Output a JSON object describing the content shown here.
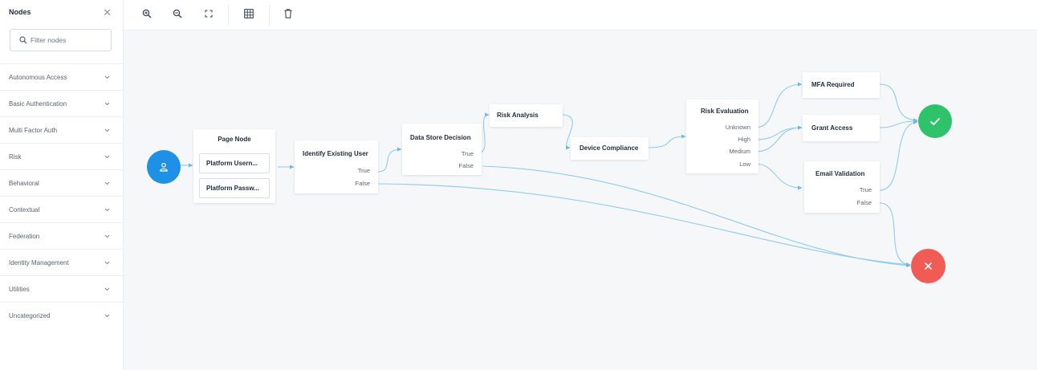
{
  "sidebar": {
    "title": "Nodes",
    "search_placeholder": "Filter nodes",
    "categories": [
      "Autonomous Access",
      "Basic Authentication",
      "Multi Factor Auth",
      "Risk",
      "Behavioral",
      "Contextual",
      "Federation",
      "Identity Management",
      "Utilities",
      "Uncategorized"
    ]
  },
  "toolbar": {
    "buttons": [
      "zoom-in-icon",
      "zoom-out-icon",
      "fit-screen-icon",
      "grid-icon",
      "trash-icon"
    ]
  },
  "colors": {
    "start": "#1e90e6",
    "success": "#2ec36b",
    "failure": "#f05b55",
    "wire": "#8ecbf0"
  },
  "canvas": {
    "nodes": {
      "page_node": {
        "title": "Page Node",
        "children": [
          "Platform Usern...",
          "Platform Passw..."
        ]
      },
      "identify_existing_user": {
        "title": "Identify Existing User",
        "outcomes": [
          "True",
          "False"
        ]
      },
      "data_store_decision": {
        "title": "Data Store Decision",
        "outcomes": [
          "True",
          "False"
        ]
      },
      "risk_analysis": {
        "title": "Risk Analysis"
      },
      "device_compliance": {
        "title": "Device Compliance"
      },
      "risk_evaluation": {
        "title": "Risk Evaluation",
        "outcomes": [
          "Unknown",
          "High",
          "Medium",
          "Low"
        ]
      },
      "mfa_required": {
        "title": "MFA Required"
      },
      "grant_access": {
        "title": "Grant Access"
      },
      "email_validation": {
        "title": "Email Validation",
        "outcomes": [
          "True",
          "False"
        ]
      }
    }
  }
}
